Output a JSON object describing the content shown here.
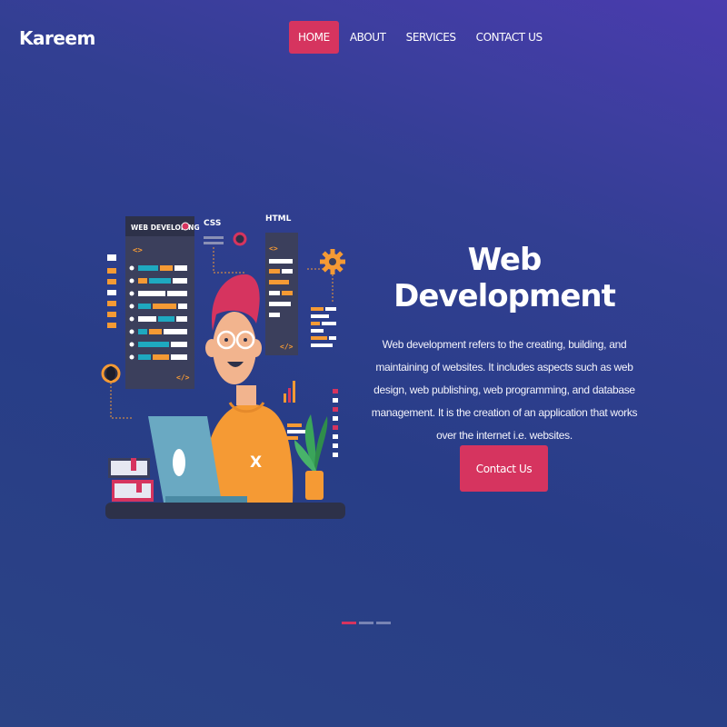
{
  "brand": {
    "name": "Kareem"
  },
  "nav": {
    "items": [
      {
        "label": "HOME",
        "active": true
      },
      {
        "label": "ABOUT",
        "active": false
      },
      {
        "label": "SERVICES",
        "active": false
      },
      {
        "label": "CONTACT US",
        "active": false
      }
    ]
  },
  "illustration": {
    "panel_title": "WEB DEVELOPING",
    "css_label": "CSS",
    "html_label": "HTML",
    "code_glyph": "<>",
    "close_tag_glyph": "</>",
    "shirt_letter": "X"
  },
  "hero": {
    "title": "Web Development",
    "description": "Web development refers to the creating, building, and maintaining of websites. It includes aspects such as web design, web publishing, web programming, and database management. It is the creation of an application that works over the internet i.e. websites.",
    "cta_label": "Contact Us"
  },
  "carousel": {
    "slide_count": 3,
    "active_index": 0
  },
  "colors": {
    "accent": "#d6345f",
    "orange": "#f59a34",
    "teal": "#1ea9c0",
    "panel": "#3b3f5c"
  }
}
